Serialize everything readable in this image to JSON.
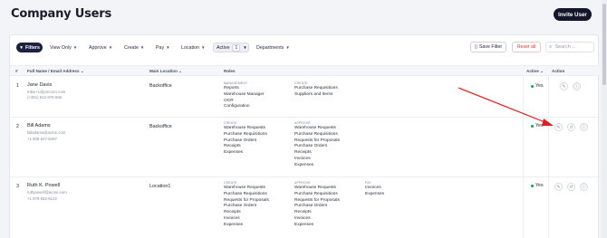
{
  "header": {
    "title": "Company Users",
    "invite_label": "Invite User"
  },
  "filters": {
    "filters_label": "Filters",
    "chips": [
      "View Only",
      "Approve",
      "Create",
      "Pay",
      "Location"
    ],
    "active_label": "Active",
    "active_count": "1",
    "departments_label": "Departments",
    "save_filter_label": "Save Filter",
    "reset_label": "Reset all",
    "search_placeholder": "Search ..."
  },
  "table": {
    "columns": {
      "index": "#",
      "name": "Full Name / Email Address",
      "location": "Main Location",
      "roles": "Roles",
      "active": "Active",
      "action": "Action"
    },
    "rows": [
      {
        "index": "1",
        "name": "Jane Davis",
        "email": "mike+1@precoro.com",
        "phone": "(+351) 912-878-665",
        "location": "Backoffice",
        "groups": [
          {
            "head": "MANAGEMENT",
            "items": [
              "Reports",
              "Warehouse Manager",
              "OCR",
              "Configuration"
            ]
          },
          {
            "head": "CREATE",
            "items": [
              "Purchase Requisitions",
              "Suppliers and Items"
            ]
          }
        ],
        "active": "Yes"
      },
      {
        "index": "2",
        "name": "Bill Adams",
        "email": "billadams@acme.com",
        "phone": "+1 808-547-8497",
        "location": "Backoffice",
        "groups": [
          {
            "head": "CREATE",
            "items": [
              "Warehouse Requests",
              "Purchase Requisitions",
              "Purchase Orders",
              "Receipts",
              "Expenses"
            ]
          },
          {
            "head": "APPROVE",
            "items": [
              "Warehouse Requests",
              "Purchase Requisitions",
              "Requests for Proposals",
              "Purchase Orders",
              "Receipts",
              "Invoices",
              "Expenses"
            ]
          }
        ],
        "active": "Yes"
      },
      {
        "index": "3",
        "name": "Ruth K. Powell",
        "email": "ruthpowell@acme.com",
        "phone": "+1 978-562-8122",
        "location": "Location1",
        "groups": [
          {
            "head": "CREATE",
            "items": [
              "Warehouse Requests",
              "Purchase Requisitions",
              "Requests for Proposals",
              "Purchase Orders",
              "Receipts",
              "Invoices",
              "Expenses"
            ]
          },
          {
            "head": "APPROVE",
            "items": [
              "Warehouse Requests",
              "Purchase Requisitions",
              "Requests for Proposals",
              "Purchase Orders",
              "Receipts",
              "Invoices",
              "Expenses"
            ]
          },
          {
            "head": "PAY",
            "items": [
              "Invoices",
              "Expenses"
            ]
          }
        ],
        "active": "Yes"
      }
    ]
  },
  "colors": {
    "brand_dark": "#14172b",
    "active_green": "#1f9d55",
    "reset_red": "#d23c3c",
    "arrow_red": "#e02020"
  },
  "icons": {
    "edit": "pencil-icon",
    "history": "history-icon",
    "info": "info-icon",
    "search": "search-icon",
    "bookmark": "bookmark-icon",
    "filter": "filter-icon"
  }
}
